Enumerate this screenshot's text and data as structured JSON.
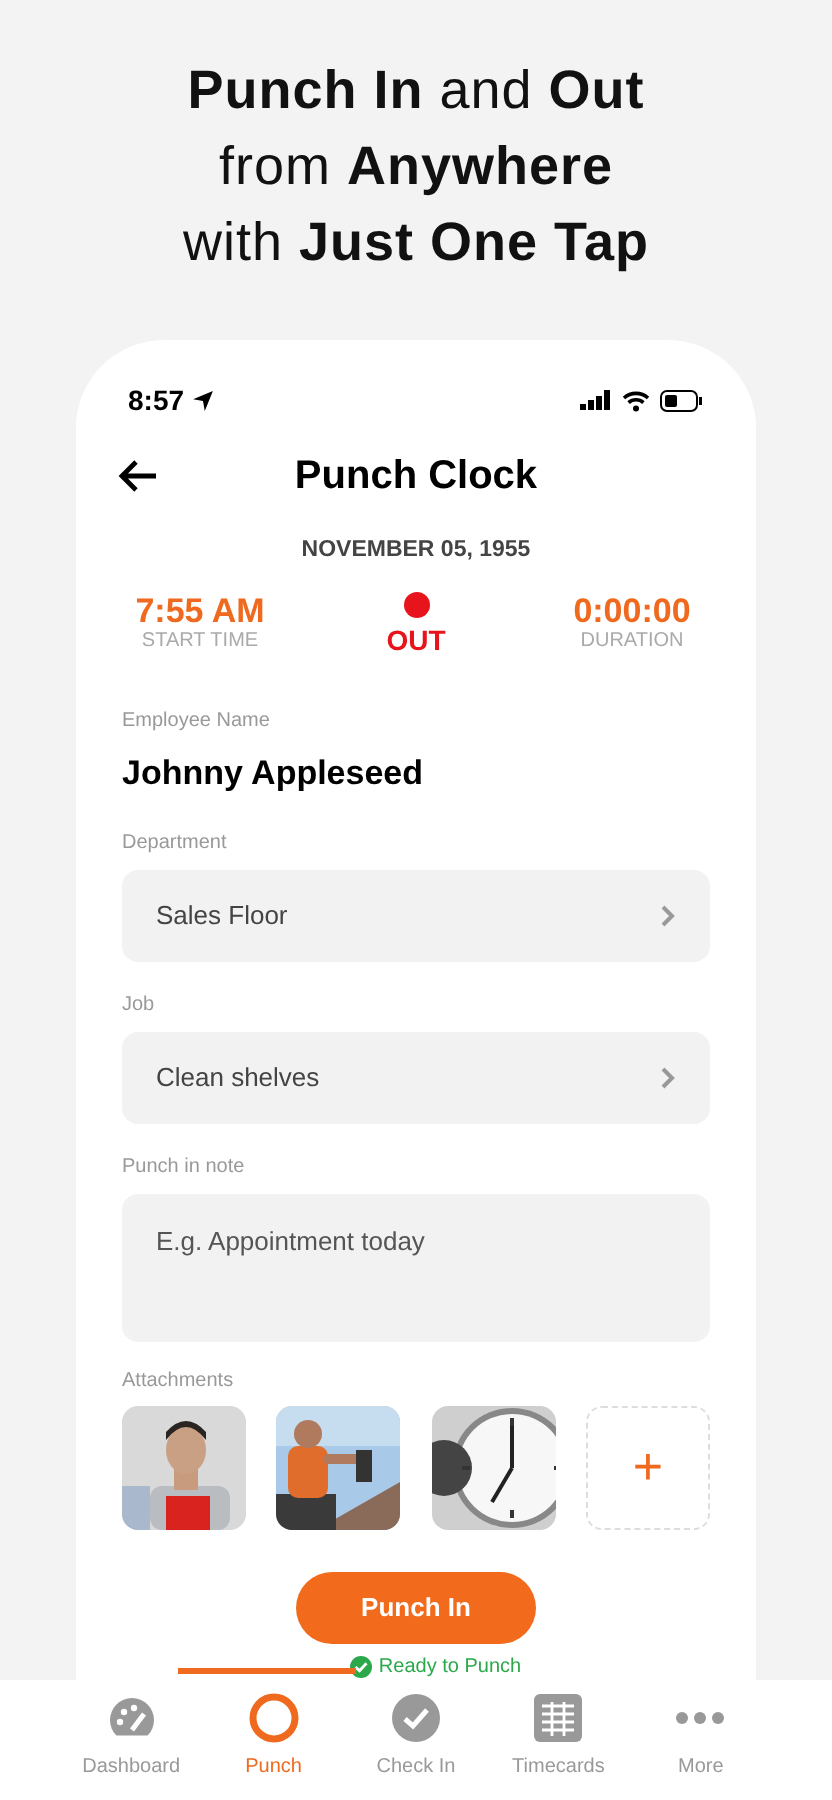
{
  "headline": [
    "**Punch In** and **Out**",
    "from **Anywhere**",
    "with **Just One Tap**"
  ],
  "status_bar": {
    "time": "8:57"
  },
  "header": {
    "title": "Punch Clock"
  },
  "date": "NOVEMBER 05, 1955",
  "stats": [
    {
      "kind": "value",
      "value": "7:55 AM",
      "label": "START TIME"
    },
    {
      "kind": "status",
      "value": "OUT",
      "color": "#e8141b"
    },
    {
      "kind": "value",
      "value": "0:00:00",
      "label": "DURATION"
    }
  ],
  "employee": {
    "label": "Employee Name",
    "value": "Johnny Appleseed"
  },
  "fields": [
    {
      "kind": "select",
      "label": "Department",
      "value": "Sales Floor"
    },
    {
      "kind": "select",
      "label": "Job",
      "value": "Clean shelves"
    },
    {
      "kind": "note",
      "label": "Punch in note",
      "placeholder": "E.g. Appointment today"
    }
  ],
  "attachments": {
    "label": "Attachments",
    "items": [
      {
        "kind": "picture"
      },
      {
        "kind": "picture"
      },
      {
        "kind": "picture"
      },
      {
        "kind": "add",
        "symbol": "+"
      }
    ]
  },
  "punch_button": "Punch In",
  "ready_status": "Ready to Punch",
  "tabs": [
    {
      "label": "Dashboard",
      "selected": false
    },
    {
      "label": "Punch",
      "selected": true
    },
    {
      "label": "Check In",
      "selected": false
    },
    {
      "label": "Timecards",
      "selected": false
    },
    {
      "label": "More",
      "selected": false
    }
  ]
}
